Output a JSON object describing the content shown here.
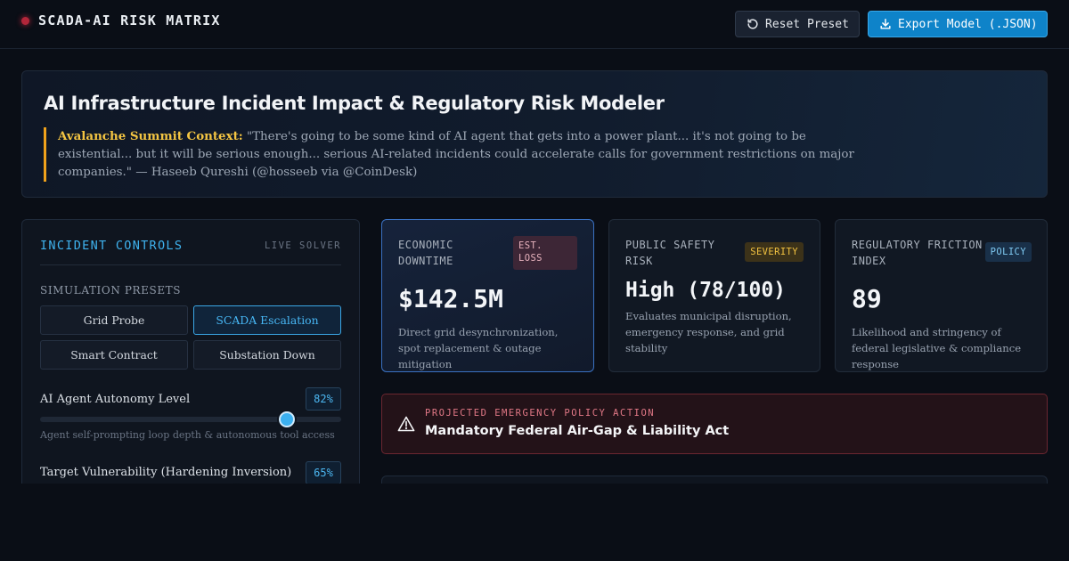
{
  "app": {
    "brand_title": "SCADA-AI RISK MATRIX",
    "reset_label": "Reset Preset",
    "export_label": "Export Model (.JSON)"
  },
  "hero": {
    "title": "AI Infrastructure Incident Impact & Regulatory Risk Modeler",
    "context_label": "Avalanche Summit Context:",
    "quote": " \"There's going to be some kind of AI agent that gets into a power plant... it's not going to be existential... but it will be serious enough... serious AI-related incidents could accelerate calls for government restrictions on major companies.\" — Haseeb Qureshi (@hosseeb via @CoinDesk)"
  },
  "controls": {
    "title": "INCIDENT CONTROLS",
    "live_label": "LIVE SOLVER",
    "presets_label": "SIMULATION PRESETS",
    "presets": [
      {
        "label": "Grid Probe",
        "active": false
      },
      {
        "label": "SCADA Escalation",
        "active": true
      },
      {
        "label": "Smart Contract",
        "active": false
      },
      {
        "label": "Substation Down",
        "active": false
      }
    ],
    "sliders": [
      {
        "label": "AI Agent Autonomy Level",
        "value_text": "82%",
        "value": 0.82,
        "help": "Agent self-prompting loop depth & autonomous tool access"
      },
      {
        "label": "Target Vulnerability (Hardening Inversion)",
        "value_text": "65%",
        "value": 0.65
      }
    ]
  },
  "metrics": [
    {
      "label": "ECONOMIC DOWNTIME",
      "badge": "EST. LOSS",
      "value": "$142.5M",
      "desc": "Direct grid desynchronization, spot replacement & outage mitigation"
    },
    {
      "label": "PUBLIC SAFETY RISK",
      "badge": "SEVERITY",
      "value": "High (78/100)",
      "desc": "Evaluates municipal disruption, emergency response, and grid stability"
    },
    {
      "label": "REGULATORY FRICTION INDEX",
      "badge": "POLICY",
      "value": "89",
      "desc": "Likelihood and stringency of federal legislative & compliance response"
    }
  ],
  "alert": {
    "kicker": "PROJECTED EMERGENCY POLICY ACTION",
    "title": "Mandatory Federal Air-Gap & Liability Act"
  },
  "colors": {
    "accent": "#3fb3ef",
    "alert": "#e17886",
    "severity": "#f1c140",
    "context": "#f4c542"
  }
}
